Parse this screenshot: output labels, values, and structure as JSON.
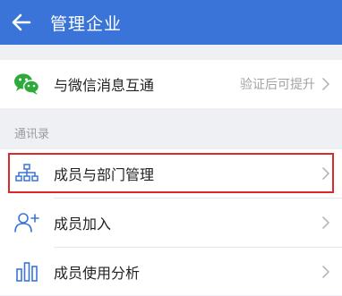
{
  "header": {
    "title": "管理企业",
    "back_icon": "arrow-left-icon",
    "background": "#3a74d8"
  },
  "wechat_row": {
    "label": "与微信消息互通",
    "hint": "验证后可提升",
    "icon": "wechat-icon",
    "icon_color": "#2dab3a"
  },
  "contacts": {
    "section_label": "通讯录",
    "items": [
      {
        "label": "成员与部门管理",
        "icon": "org-chart-icon",
        "highlighted": true
      },
      {
        "label": "成员加入",
        "icon": "add-person-icon"
      },
      {
        "label": "成员使用分析",
        "icon": "bar-chart-icon"
      }
    ]
  },
  "accent_color": "#3a74d8",
  "highlight_color": "#d9292b"
}
